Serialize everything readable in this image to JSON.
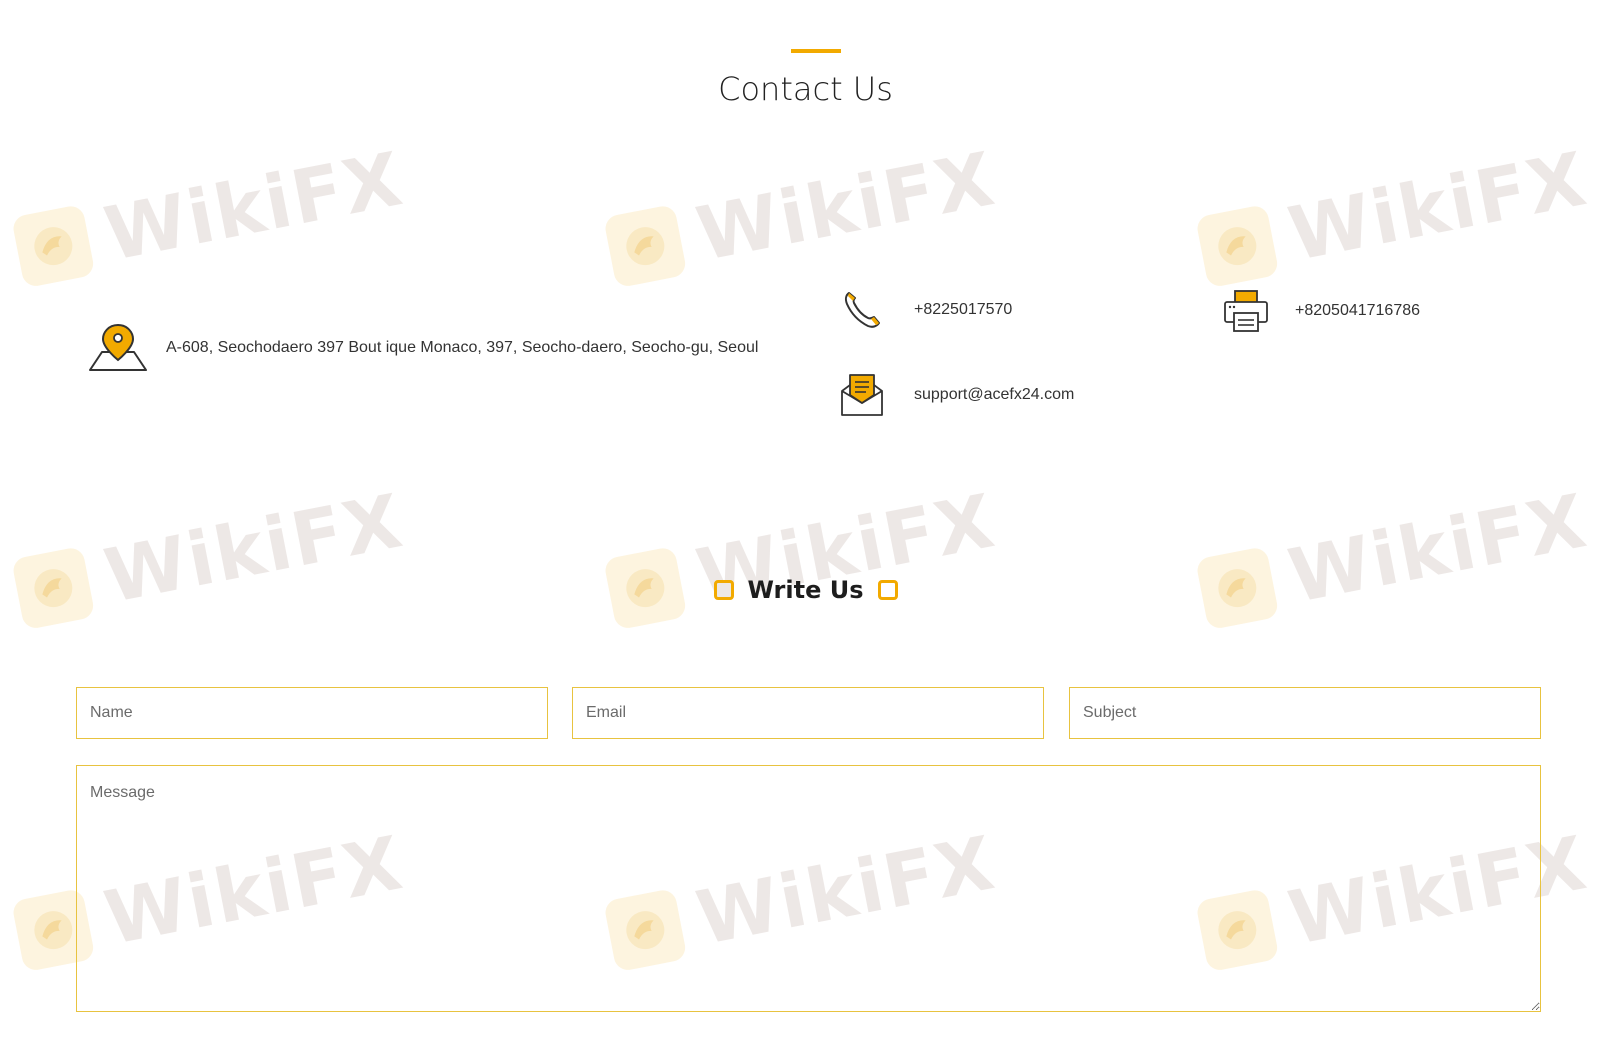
{
  "header": {
    "title": "Contact Us"
  },
  "contact": {
    "address": "A-608, Seochodaero 397 Bout ique Monaco, 397, Seocho-daero, Seocho-gu, Seoul",
    "phone": "+8225017570",
    "fax": "+8205041716786",
    "email": "support@acefx24.com"
  },
  "form": {
    "title": "Write Us",
    "name_placeholder": "Name",
    "email_placeholder": "Email",
    "subject_placeholder": "Subject",
    "message_placeholder": "Message"
  },
  "watermark": {
    "text": "WikiFX"
  },
  "colors": {
    "accent": "#f2aa00",
    "field_border": "#e8c340",
    "watermark_text": "#ece6e4"
  },
  "icons": [
    "map-pin-icon",
    "phone-icon",
    "printer-icon",
    "mail-envelope-icon"
  ]
}
